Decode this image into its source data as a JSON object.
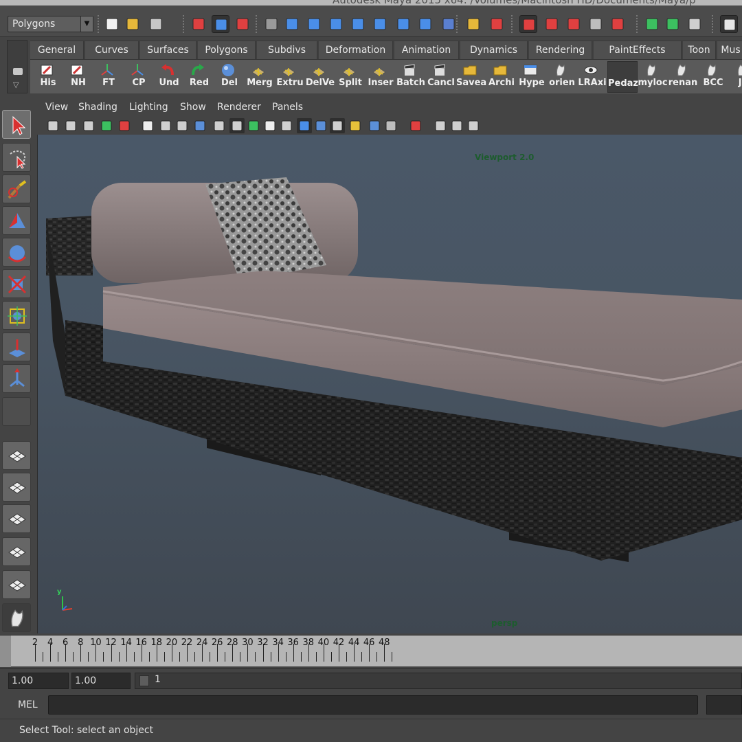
{
  "window": {
    "title": "Autodesk Maya 2015 x64: /Volumes/Macintosh HD/Documents/Maya/p"
  },
  "status_line": {
    "mode": "Polygons",
    "icons": [
      "new-scene-icon",
      "open-scene-icon",
      "save-scene-icon",
      "select-hierarchy-icon",
      "select-object-icon",
      "select-component-icon",
      "filter-icon",
      "snap-grid-icon",
      "snap-curve-icon",
      "snap-point-icon",
      "snap-plane-icon",
      "snap-live-icon",
      "snap-view-icon",
      "snap-surface-icon",
      "help-icon",
      "lock-icon",
      "select-highlight-icon",
      "history-icon",
      "construction-icon",
      "magnet-icon",
      "soft-select-icon",
      "symmetry-icon",
      "render-current-icon",
      "ipr-icon",
      "render-settings-icon",
      "sidebar-toggle-icon"
    ]
  },
  "shelf": {
    "tabs": [
      "General",
      "Curves",
      "Surfaces",
      "Polygons",
      "Subdivs",
      "Deformation",
      "Animation",
      "Dynamics",
      "Rendering",
      "PaintEffects",
      "Toon",
      "Mus"
    ],
    "buttons": [
      {
        "label": "His",
        "icon": "notepad-icon"
      },
      {
        "label": "NH",
        "icon": "notepad-icon"
      },
      {
        "label": "FT",
        "icon": "axes-icon"
      },
      {
        "label": "CP",
        "icon": "axes-icon"
      },
      {
        "label": "Und",
        "icon": "undo-arrow-icon"
      },
      {
        "label": "Red",
        "icon": "redo-arrow-icon"
      },
      {
        "label": "Del",
        "icon": "sphere-icon"
      },
      {
        "label": "Merg",
        "icon": "merge-icon"
      },
      {
        "label": "Extru",
        "icon": "extrude-icon"
      },
      {
        "label": "DelVe",
        "icon": "delete-vertex-icon"
      },
      {
        "label": "Split",
        "icon": "split-icon"
      },
      {
        "label": "Inser",
        "icon": "insert-loop-icon"
      },
      {
        "label": "Batch",
        "icon": "clapper-icon"
      },
      {
        "label": "Cancl",
        "icon": "clapper-icon"
      },
      {
        "label": "Savea",
        "icon": "folder-icon"
      },
      {
        "label": "Archi",
        "icon": "folder-icon"
      },
      {
        "label": "Hype",
        "icon": "window-icon"
      },
      {
        "label": "orien",
        "icon": "script-icon"
      },
      {
        "label": "LRAxi",
        "icon": "eye-icon"
      },
      {
        "label": "Pedaz",
        "icon": "blank-icon"
      },
      {
        "label": "myloc",
        "icon": "script-icon"
      },
      {
        "label": "renan",
        "icon": "script-icon"
      },
      {
        "label": "BCC",
        "icon": "script-icon"
      },
      {
        "label": "JC",
        "icon": "script-icon"
      }
    ]
  },
  "toolbox": {
    "tools": [
      "select-tool-icon",
      "lasso-tool-icon",
      "paint-select-icon",
      "move-tool-icon",
      "rotate-tool-icon",
      "scale-tool-icon",
      "universal-manip-icon",
      "soft-mod-icon",
      "show-manipulator-icon",
      "last-tool-icon"
    ],
    "layouts": [
      "single-pane-layout-icon",
      "four-pane-layout-icon",
      "outliner-persp-layout-icon",
      "persp-graph-layout-icon",
      "hypershade-persp-layout-icon",
      "script-icon"
    ]
  },
  "viewport": {
    "menus": [
      "View",
      "Shading",
      "Lighting",
      "Show",
      "Renderer",
      "Panels"
    ],
    "renderer_label": "Viewport 2.0",
    "camera_label": "persp",
    "axis_label": "y"
  },
  "time_slider": {
    "ticks": [
      "2",
      "4",
      "6",
      "8",
      "10",
      "12",
      "14",
      "16",
      "18",
      "20",
      "22",
      "24",
      "26",
      "28",
      "30",
      "32",
      "34",
      "36",
      "38",
      "40",
      "42",
      "44",
      "46",
      "48"
    ]
  },
  "range_slider": {
    "start_time": "1.00",
    "playback_start": "1.00",
    "current_frame": "1"
  },
  "command_line": {
    "language": "MEL"
  },
  "help_line": {
    "text": "Select Tool: select an object"
  },
  "colors": {
    "accent": "#e04040",
    "viewport_bg_top": "#4a5868",
    "viewport_bg_bottom": "#3f4751",
    "hud_text": "#1d5c2e"
  }
}
